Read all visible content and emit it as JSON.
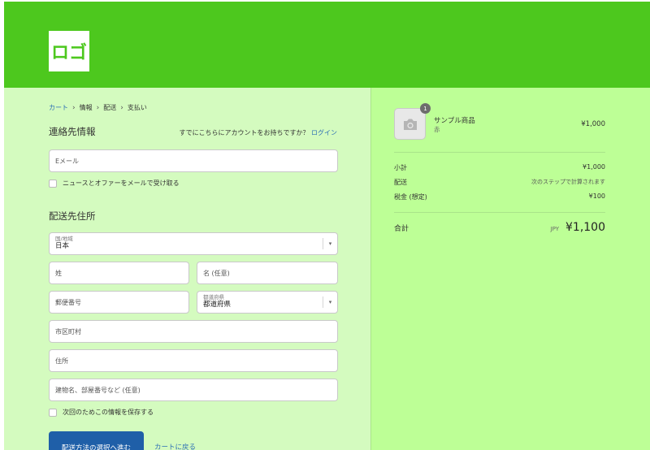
{
  "header": {
    "logo_text": "ロゴ"
  },
  "breadcrumb": [
    {
      "label": "カート"
    },
    {
      "label": "情報"
    },
    {
      "label": "配送"
    },
    {
      "label": "支払い"
    }
  ],
  "contact": {
    "title": "連絡先情報",
    "login_prompt": "すでにこちらにアカウントをお持ちですか？",
    "login_link": "ログイン",
    "email_placeholder": "Eメール",
    "newsletter_label": "ニュースとオファーをメールで受け取る"
  },
  "shipping": {
    "title": "配送先住所",
    "country_label": "国/地域",
    "country_value": "日本",
    "last_name": "姓",
    "first_name": "名 (任意)",
    "postal": "郵便番号",
    "prefecture_label": "都道府県",
    "prefecture_value": "都道府県",
    "city": "市区町村",
    "address": "住所",
    "building": "建物名、部屋番号など (任意)",
    "save_label": "次回のためこの情報を保存する"
  },
  "actions": {
    "continue_label": "配送方法の選択へ進む",
    "back_label": "カートに戻る"
  },
  "order": {
    "item": {
      "quantity": "1",
      "name": "サンプル商品",
      "variant": "赤",
      "price": "¥1,000"
    },
    "subtotal_label": "小計",
    "subtotal_value": "¥1,000",
    "shipping_label": "配送",
    "shipping_value": "次のステップで計算されます",
    "tax_label": "税金 (想定)",
    "tax_value": "¥100",
    "total_label": "合計",
    "currency": "JPY",
    "total_value": "¥1,100"
  },
  "colors": {
    "header": "#4dc81e",
    "main_bg": "#d4fbbf",
    "side_bg": "#bdff96",
    "primary_button": "#1f5fa8",
    "link": "#2d6fb5"
  }
}
